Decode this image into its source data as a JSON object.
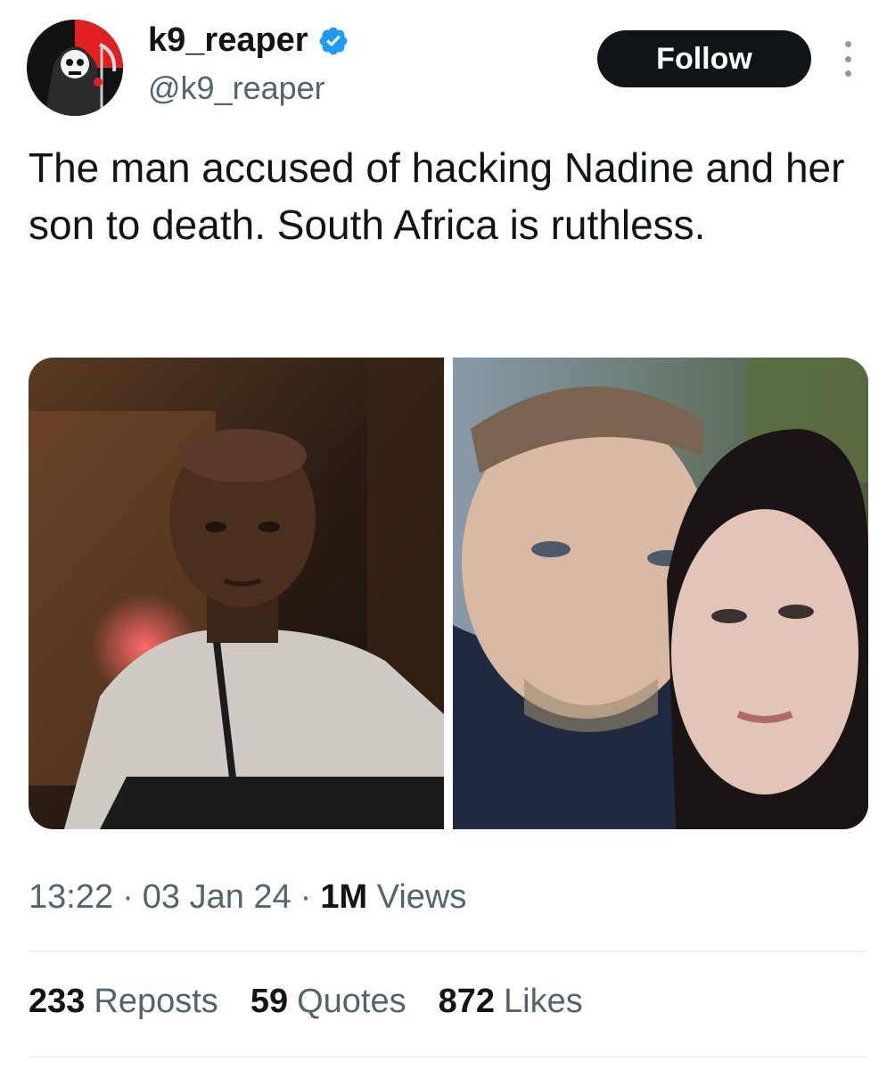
{
  "header": {
    "display_name": "k9_reaper",
    "handle": "@k9_reaper",
    "follow_label": "Follow",
    "verified_color": "#1d9bf0",
    "avatar_icon": "grim-reaper-icon"
  },
  "tweet": {
    "text": "The man accused of hacking Nadine and her son to death. South Africa is ruthless."
  },
  "media": [
    {
      "icon": "photo-accused-man"
    },
    {
      "icon": "photo-couple-selfie"
    }
  ],
  "meta": {
    "time": "13:22",
    "date": "03 Jan 24",
    "views_count": "1M",
    "views_label": "Views",
    "separator": "·"
  },
  "stats": {
    "reposts_count": "233",
    "reposts_label": "Reposts",
    "quotes_count": "59",
    "quotes_label": "Quotes",
    "likes_count": "872",
    "likes_label": "Likes"
  },
  "colors": {
    "text_primary": "#0f1419",
    "text_secondary": "#536471",
    "divider": "#eff3f4",
    "button_bg": "#0f1419"
  }
}
